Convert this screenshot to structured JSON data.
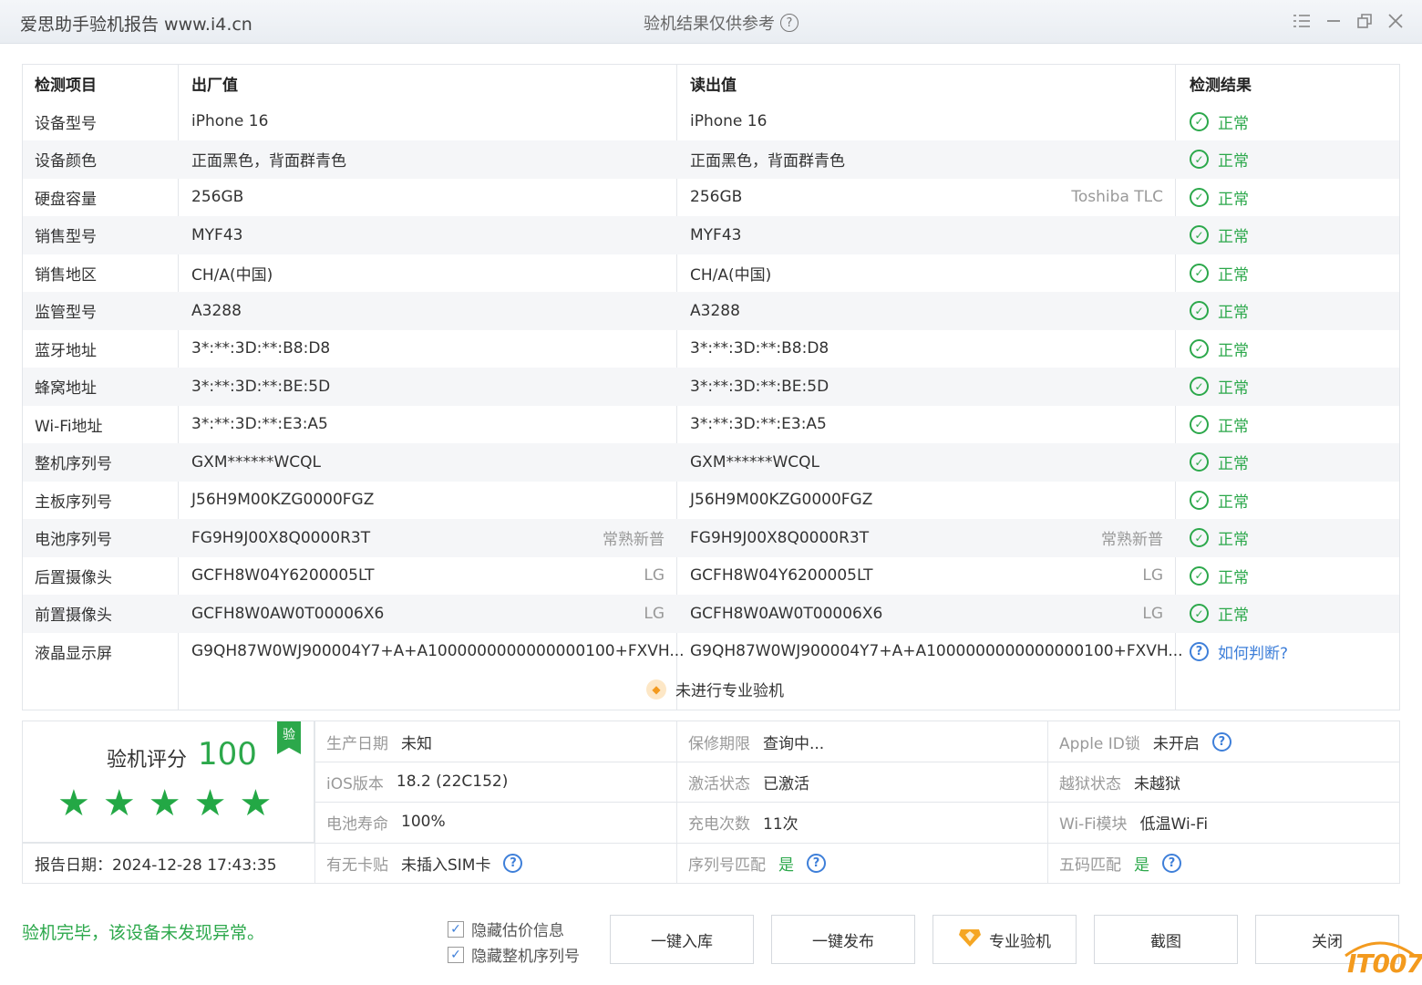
{
  "titlebar": {
    "app_title": "爱思助手验机报告 www.i4.cn",
    "center_title": "验机结果仅供参考",
    "help_glyph": "?"
  },
  "table": {
    "headers": {
      "name": "检测项目",
      "factory": "出厂值",
      "read": "读出值",
      "result": "检测结果"
    },
    "rows": [
      {
        "name": "设备型号",
        "factory": "iPhone 16",
        "factory_sub": "",
        "read": "iPhone 16",
        "read_sub": "",
        "result": "正常",
        "status": "ok"
      },
      {
        "name": "设备颜色",
        "factory": "正面黑色，背面群青色",
        "factory_sub": "",
        "read": "正面黑色，背面群青色",
        "read_sub": "",
        "result": "正常",
        "status": "ok"
      },
      {
        "name": "硬盘容量",
        "factory": "256GB",
        "factory_sub": "",
        "read": "256GB",
        "read_sub": "Toshiba TLC",
        "result": "正常",
        "status": "ok"
      },
      {
        "name": "销售型号",
        "factory": "MYF43",
        "factory_sub": "",
        "read": "MYF43",
        "read_sub": "",
        "result": "正常",
        "status": "ok"
      },
      {
        "name": "销售地区",
        "factory": "CH/A(中国)",
        "factory_sub": "",
        "read": "CH/A(中国)",
        "read_sub": "",
        "result": "正常",
        "status": "ok"
      },
      {
        "name": "监管型号",
        "factory": "A3288",
        "factory_sub": "",
        "read": "A3288",
        "read_sub": "",
        "result": "正常",
        "status": "ok"
      },
      {
        "name": "蓝牙地址",
        "factory": "3*:**:3D:**:B8:D8",
        "factory_sub": "",
        "read": "3*:**:3D:**:B8:D8",
        "read_sub": "",
        "result": "正常",
        "status": "ok"
      },
      {
        "name": "蜂窝地址",
        "factory": "3*:**:3D:**:BE:5D",
        "factory_sub": "",
        "read": "3*:**:3D:**:BE:5D",
        "read_sub": "",
        "result": "正常",
        "status": "ok"
      },
      {
        "name": "Wi-Fi地址",
        "factory": "3*:**:3D:**:E3:A5",
        "factory_sub": "",
        "read": "3*:**:3D:**:E3:A5",
        "read_sub": "",
        "result": "正常",
        "status": "ok"
      },
      {
        "name": "整机序列号",
        "factory": "GXM******WCQL",
        "factory_sub": "",
        "read": "GXM******WCQL",
        "read_sub": "",
        "result": "正常",
        "status": "ok"
      },
      {
        "name": "主板序列号",
        "factory": "J56H9M00KZG0000FGZ",
        "factory_sub": "",
        "read": "J56H9M00KZG0000FGZ",
        "read_sub": "",
        "result": "正常",
        "status": "ok"
      },
      {
        "name": "电池序列号",
        "factory": "FG9H9J00X8Q0000R3T",
        "factory_sub": "常熟新普",
        "read": "FG9H9J00X8Q0000R3T",
        "read_sub": "常熟新普",
        "result": "正常",
        "status": "ok"
      },
      {
        "name": "后置摄像头",
        "factory": "GCFH8W04Y6200005LT",
        "factory_sub": "LG",
        "read": "GCFH8W04Y6200005LT",
        "read_sub": "LG",
        "result": "正常",
        "status": "ok"
      },
      {
        "name": "前置摄像头",
        "factory": "GCFH8W0AW0T00006X6",
        "factory_sub": "LG",
        "read": "GCFH8W0AW0T00006X6",
        "read_sub": "LG",
        "result": "正常",
        "status": "ok"
      },
      {
        "name": "液晶显示屏",
        "factory": "G9QH87W0WJ900004Y7+A+A1000000000000000100+FXVH...",
        "factory_sub": "",
        "read": "G9QH87W0WJ900004Y7+A+A1000000000000000100+FXVH...",
        "read_sub": "",
        "result": "如何判断?",
        "status": "question"
      }
    ],
    "pro_note": "未进行专业验机"
  },
  "summary": {
    "score_label": "验机评分",
    "score_value": "100",
    "star_count": 5,
    "badge": "验",
    "report_date": "报告日期：2024-12-28 17:43:35",
    "items": [
      {
        "key": "生产日期",
        "value": "未知",
        "help": false,
        "green": false
      },
      {
        "key": "保修期限",
        "value": "查询中...",
        "help": false,
        "green": false
      },
      {
        "key": "Apple ID锁",
        "value": "未开启",
        "help": true,
        "green": false
      },
      {
        "key": "iOS版本",
        "value": "18.2 (22C152)",
        "help": false,
        "green": false
      },
      {
        "key": "激活状态",
        "value": "已激活",
        "help": false,
        "green": false
      },
      {
        "key": "越狱状态",
        "value": "未越狱",
        "help": false,
        "green": false
      },
      {
        "key": "电池寿命",
        "value": "100%",
        "help": false,
        "green": false
      },
      {
        "key": "充电次数",
        "value": "11次",
        "help": false,
        "green": false
      },
      {
        "key": "Wi-Fi模块",
        "value": "低温Wi-Fi",
        "help": false,
        "green": false
      },
      {
        "key": "有无卡贴",
        "value": "未插入SIM卡",
        "help": true,
        "green": false
      },
      {
        "key": "序列号匹配",
        "value": "是",
        "help": true,
        "green": true
      },
      {
        "key": "五码匹配",
        "value": "是",
        "help": true,
        "green": true
      }
    ]
  },
  "footer": {
    "done_message": "验机完毕，该设备未发现异常。",
    "hide_price": "隐藏估价信息",
    "hide_serial": "隐藏整机序列号",
    "buttons": {
      "stock_in": "一键入库",
      "publish": "一键发布",
      "pro_check": "专业验机",
      "screenshot": "截图",
      "close": "关闭"
    },
    "watermark": "IT007"
  },
  "colors": {
    "ok_green": "#2ca84b",
    "link_blue": "#3e7fd9",
    "accent_orange": "#f39a1e"
  },
  "icons": {
    "ok": "check-circle-icon",
    "question": "question-circle-icon",
    "star": "star-icon",
    "diamond": "diamond-icon"
  }
}
